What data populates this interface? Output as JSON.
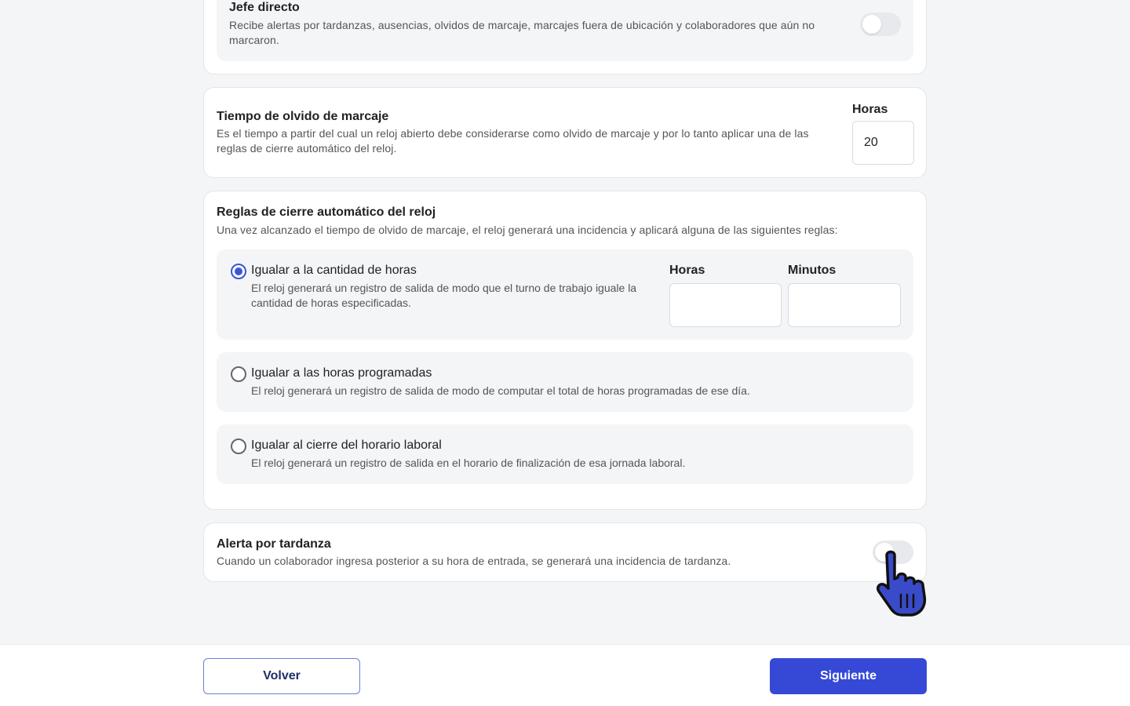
{
  "jefe_directo": {
    "title": "Jefe directo",
    "description": "Recibe alertas por tardanzas, ausencias, olvidos de marcaje, marcajes fuera de ubicación y colaboradores que aún no marcaron.",
    "toggle_on": false
  },
  "tiempo_olvido": {
    "title": "Tiempo de olvido de marcaje",
    "description": "Es el tiempo a partir del cual un reloj abierto debe considerarse como olvido de marcaje y por lo tanto aplicar una de las reglas de cierre automático del reloj.",
    "hours_label": "Horas",
    "hours_value": "20"
  },
  "reglas_cierre": {
    "title": "Reglas de cierre automático del reloj",
    "description": "Una vez alcanzado el tiempo de olvido de marcaje, el reloj generará una incidencia y aplicará alguna de las siguientes reglas:",
    "options": [
      {
        "title": "Igualar a la cantidad de horas",
        "description": "El reloj generará un registro de salida de modo que el turno de trabajo iguale la cantidad de horas especificadas.",
        "selected": true,
        "hours_label": "Horas",
        "hours_value": "",
        "minutes_label": "Minutos",
        "minutes_value": ""
      },
      {
        "title": "Igualar a las horas programadas",
        "description": "El reloj generará un registro de salida de modo de computar el total de horas programadas de ese día.",
        "selected": false
      },
      {
        "title": "Igualar al cierre del horario laboral",
        "description": "El reloj generará un registro de salida en el horario de finalización de esa jornada laboral.",
        "selected": false
      }
    ]
  },
  "alerta_tardanza": {
    "title": "Alerta por tardanza",
    "description": "Cuando un colaborador ingresa posterior a su hora de entrada, se generará una incidencia de tardanza.",
    "toggle_on": false
  },
  "footer": {
    "back_label": "Volver",
    "next_label": "Siguiente"
  },
  "colors": {
    "accent": "#3549d6",
    "radio_selected": "#3b56d6",
    "option_bg": "#f4f5f7",
    "cursor_fill": "#3a4bc9"
  },
  "icons": {
    "cursor": "hand-pointer-icon"
  }
}
